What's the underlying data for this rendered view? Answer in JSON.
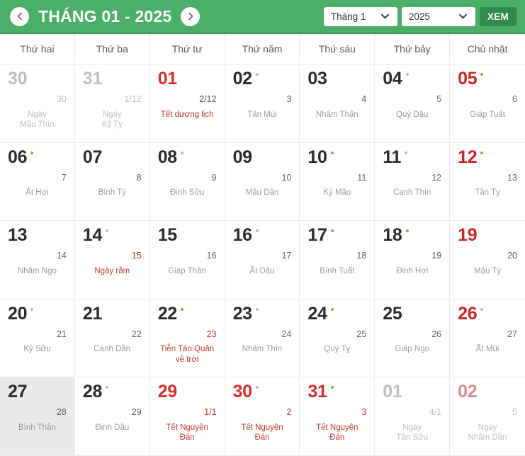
{
  "header": {
    "prev_label": "chevron-left",
    "next_label": "chevron-right",
    "title": "THÁNG 01 - 2025",
    "month_select": "Tháng 1",
    "year_select": "2025",
    "view_button": "XEM",
    "brand_green": "#4caf67",
    "button_green": "#2f8a4c"
  },
  "weekdays": [
    "Thứ hai",
    "Thứ ba",
    "Thứ tư",
    "Thứ năm",
    "Thứ sáu",
    "Thứ bảy",
    "Chủ nhật"
  ],
  "days": [
    {
      "solar": "30",
      "lunar": "30",
      "event": "Ngày\nMậu Thìn",
      "other": true,
      "sunday": false,
      "holiday": false,
      "dot": "none",
      "lunar_red": false,
      "event_red": false,
      "today": false
    },
    {
      "solar": "31",
      "lunar": "1/12",
      "event": "Ngày\nKỷ Tỵ",
      "other": true,
      "sunday": false,
      "holiday": false,
      "dot": "none",
      "lunar_red": false,
      "event_red": false,
      "today": false
    },
    {
      "solar": "01",
      "lunar": "2/12",
      "event": "Tết dương lịch",
      "other": false,
      "sunday": false,
      "holiday": true,
      "dot": "none",
      "lunar_red": false,
      "event_red": true,
      "today": false
    },
    {
      "solar": "02",
      "lunar": "3",
      "event": "Tân Mùi",
      "other": false,
      "sunday": false,
      "holiday": false,
      "dot": "gray",
      "lunar_red": false,
      "event_red": false,
      "today": false
    },
    {
      "solar": "03",
      "lunar": "4",
      "event": "Nhâm Thân",
      "other": false,
      "sunday": false,
      "holiday": false,
      "dot": "none",
      "lunar_red": false,
      "event_red": false,
      "today": false
    },
    {
      "solar": "04",
      "lunar": "5",
      "event": "Quý Dậu",
      "other": false,
      "sunday": false,
      "holiday": false,
      "dot": "gray",
      "lunar_red": false,
      "event_red": false,
      "today": false
    },
    {
      "solar": "05",
      "lunar": "6",
      "event": "Giáp Tuất",
      "other": false,
      "sunday": true,
      "holiday": false,
      "dot": "green",
      "lunar_red": false,
      "event_red": false,
      "today": false
    },
    {
      "solar": "06",
      "lunar": "7",
      "event": "Ất Hợi",
      "other": false,
      "sunday": false,
      "holiday": false,
      "dot": "green",
      "lunar_red": false,
      "event_red": false,
      "today": false
    },
    {
      "solar": "07",
      "lunar": "8",
      "event": "Bính Tý",
      "other": false,
      "sunday": false,
      "holiday": false,
      "dot": "none",
      "lunar_red": false,
      "event_red": false,
      "today": false
    },
    {
      "solar": "08",
      "lunar": "9",
      "event": "Đinh Sửu",
      "other": false,
      "sunday": false,
      "holiday": false,
      "dot": "gray",
      "lunar_red": false,
      "event_red": false,
      "today": false
    },
    {
      "solar": "09",
      "lunar": "10",
      "event": "Mậu Dần",
      "other": false,
      "sunday": false,
      "holiday": false,
      "dot": "none",
      "lunar_red": false,
      "event_red": false,
      "today": false
    },
    {
      "solar": "10",
      "lunar": "11",
      "event": "Kỷ Mão",
      "other": false,
      "sunday": false,
      "holiday": false,
      "dot": "green",
      "lunar_red": false,
      "event_red": false,
      "today": false
    },
    {
      "solar": "11",
      "lunar": "12",
      "event": "Canh Thìn",
      "other": false,
      "sunday": false,
      "holiday": false,
      "dot": "gray",
      "lunar_red": false,
      "event_red": false,
      "today": false
    },
    {
      "solar": "12",
      "lunar": "13",
      "event": "Tân Tỵ",
      "other": false,
      "sunday": true,
      "holiday": false,
      "dot": "green",
      "lunar_red": false,
      "event_red": false,
      "today": false
    },
    {
      "solar": "13",
      "lunar": "14",
      "event": "Nhâm Ngọ",
      "other": false,
      "sunday": false,
      "holiday": false,
      "dot": "none",
      "lunar_red": false,
      "event_red": false,
      "today": false
    },
    {
      "solar": "14",
      "lunar": "15",
      "event": "Ngày rằm",
      "other": false,
      "sunday": false,
      "holiday": false,
      "dot": "gray",
      "lunar_red": true,
      "event_red": true,
      "today": false
    },
    {
      "solar": "15",
      "lunar": "16",
      "event": "Giáp Thân",
      "other": false,
      "sunday": false,
      "holiday": false,
      "dot": "none",
      "lunar_red": false,
      "event_red": false,
      "today": false
    },
    {
      "solar": "16",
      "lunar": "17",
      "event": "Ất Dậu",
      "other": false,
      "sunday": false,
      "holiday": false,
      "dot": "gray",
      "lunar_red": false,
      "event_red": false,
      "today": false
    },
    {
      "solar": "17",
      "lunar": "18",
      "event": "Bính Tuất",
      "other": false,
      "sunday": false,
      "holiday": false,
      "dot": "green",
      "lunar_red": false,
      "event_red": false,
      "today": false
    },
    {
      "solar": "18",
      "lunar": "19",
      "event": "Đinh Hợi",
      "other": false,
      "sunday": false,
      "holiday": false,
      "dot": "green",
      "lunar_red": false,
      "event_red": false,
      "today": false
    },
    {
      "solar": "19",
      "lunar": "20",
      "event": "Mậu Tý",
      "other": false,
      "sunday": true,
      "holiday": false,
      "dot": "none",
      "lunar_red": false,
      "event_red": false,
      "today": false
    },
    {
      "solar": "20",
      "lunar": "21",
      "event": "Kỷ Sửu",
      "other": false,
      "sunday": false,
      "holiday": false,
      "dot": "gray",
      "lunar_red": false,
      "event_red": false,
      "today": false
    },
    {
      "solar": "21",
      "lunar": "22",
      "event": "Canh Dần",
      "other": false,
      "sunday": false,
      "holiday": false,
      "dot": "none",
      "lunar_red": false,
      "event_red": false,
      "today": false
    },
    {
      "solar": "22",
      "lunar": "23",
      "event": "Tiễn Táo Quân\nvề trời",
      "other": false,
      "sunday": false,
      "holiday": false,
      "dot": "green",
      "lunar_red": true,
      "event_red": true,
      "today": false
    },
    {
      "solar": "23",
      "lunar": "24",
      "event": "Nhâm Thìn",
      "other": false,
      "sunday": false,
      "holiday": false,
      "dot": "gray",
      "lunar_red": false,
      "event_red": false,
      "today": false
    },
    {
      "solar": "24",
      "lunar": "25",
      "event": "Quý Tỵ",
      "other": false,
      "sunday": false,
      "holiday": false,
      "dot": "green",
      "lunar_red": false,
      "event_red": false,
      "today": false
    },
    {
      "solar": "25",
      "lunar": "26",
      "event": "Giáp Ngọ",
      "other": false,
      "sunday": false,
      "holiday": false,
      "dot": "none",
      "lunar_red": false,
      "event_red": false,
      "today": false
    },
    {
      "solar": "26",
      "lunar": "27",
      "event": "Ất Mùi",
      "other": false,
      "sunday": true,
      "holiday": false,
      "dot": "gray",
      "lunar_red": false,
      "event_red": false,
      "today": false
    },
    {
      "solar": "27",
      "lunar": "28",
      "event": "Bính Thân",
      "other": false,
      "sunday": false,
      "holiday": false,
      "dot": "none",
      "lunar_red": false,
      "event_red": false,
      "today": true
    },
    {
      "solar": "28",
      "lunar": "29",
      "event": "Đinh Dậu",
      "other": false,
      "sunday": false,
      "holiday": false,
      "dot": "gray",
      "lunar_red": false,
      "event_red": false,
      "today": false
    },
    {
      "solar": "29",
      "lunar": "1/1",
      "event": "Tết Nguyên\nĐán",
      "other": false,
      "sunday": false,
      "holiday": true,
      "dot": "none",
      "lunar_red": true,
      "event_red": true,
      "today": false
    },
    {
      "solar": "30",
      "lunar": "2",
      "event": "Tết Nguyên\nĐán",
      "other": false,
      "sunday": false,
      "holiday": true,
      "dot": "gray",
      "lunar_red": true,
      "event_red": true,
      "today": false
    },
    {
      "solar": "31",
      "lunar": "3",
      "event": "Tết Nguyên\nĐán",
      "other": false,
      "sunday": false,
      "holiday": true,
      "dot": "green",
      "lunar_red": true,
      "event_red": true,
      "today": false
    },
    {
      "solar": "01",
      "lunar": "4/1",
      "event": "Ngày\nTân Sửu",
      "other": true,
      "sunday": false,
      "holiday": false,
      "dot": "none",
      "lunar_red": false,
      "event_red": false,
      "today": false
    },
    {
      "solar": "02",
      "lunar": "5",
      "event": "Ngày\nNhâm Dần",
      "other": true,
      "sunday": true,
      "holiday": false,
      "dot": "none",
      "lunar_red": false,
      "event_red": false,
      "today": false
    }
  ]
}
